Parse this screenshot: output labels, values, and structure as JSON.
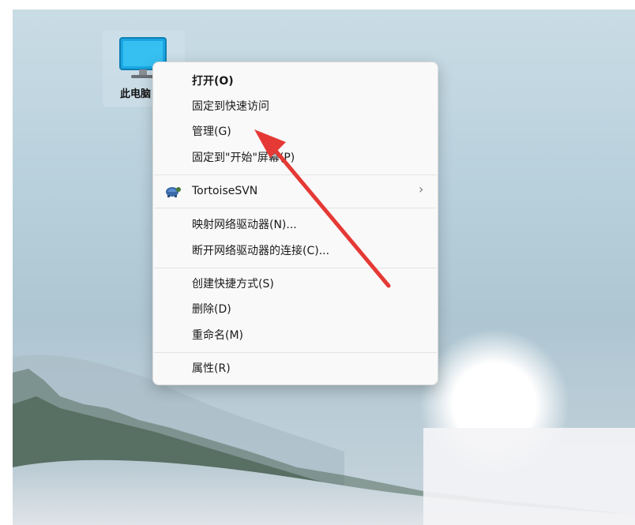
{
  "desktop": {
    "icon_label": "此电脑",
    "icon_name": "this-pc-monitor-icon"
  },
  "menu": {
    "open": "打开(O)",
    "pin_quick_access": "固定到快速访问",
    "manage": "管理(G)",
    "pin_start": "固定到\"开始\"屏幕(P)",
    "tortoisesvn": "TortoiseSVN",
    "map_drive": "映射网络驱动器(N)...",
    "disconnect_drive": "断开网络驱动器的连接(C)...",
    "create_shortcut": "创建快捷方式(S)",
    "delete": "删除(D)",
    "rename": "重命名(M)",
    "properties": "属性(R)",
    "submenu_glyph": "›"
  },
  "annotation": {
    "arrow_color": "#e53935"
  }
}
